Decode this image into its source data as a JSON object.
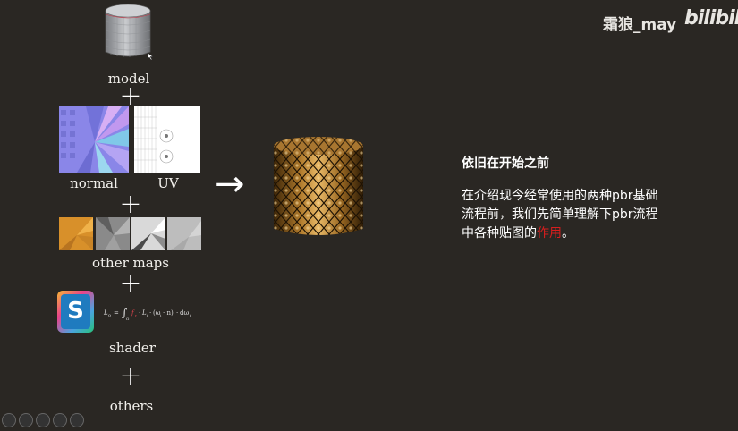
{
  "watermark": {
    "user": "霜狼_may",
    "site_logo": "bilibili"
  },
  "labels": {
    "model": "model",
    "normal": "normal",
    "uv": "UV",
    "other_maps": "other maps",
    "shader": "shader",
    "others": "others"
  },
  "plus_sign": "+",
  "arrow_glyph": "→",
  "shader_icon_letter": "S",
  "text": {
    "heading": "依旧在开始之前",
    "para_main": "在介绍现今经常使用的两种pbr基础流程前，我们先简单理解下pbr流程中各种贴图的",
    "para_highlight": "作用",
    "para_end": "。"
  },
  "colors": {
    "background": "#2a2723",
    "highlight": "#d81e1e",
    "gold": "#b07a2c"
  }
}
